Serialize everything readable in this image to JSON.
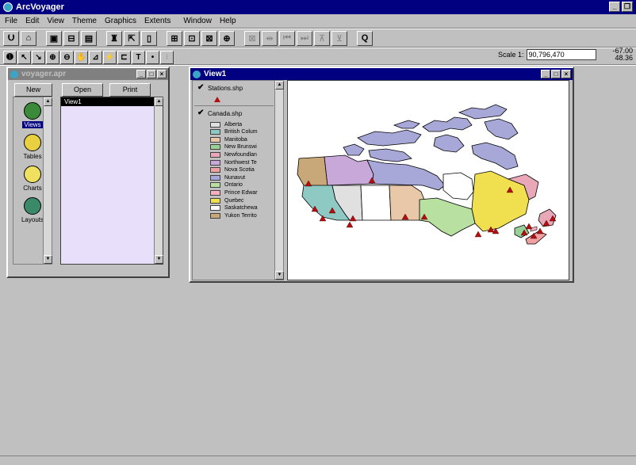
{
  "app": {
    "title": "ArcVoyager"
  },
  "menu": [
    "File",
    "Edit",
    "View",
    "Theme",
    "Graphics",
    "Extents",
    "Window",
    "Help"
  ],
  "scale": {
    "label": "Scale 1:",
    "value": "90,796,470"
  },
  "coords": {
    "x": "-67.00",
    "y": "48.36"
  },
  "project": {
    "title": "voyager.apr",
    "buttons": {
      "new": "New",
      "open": "Open",
      "print": "Print"
    },
    "doc_types": [
      "Views",
      "Tables",
      "Charts",
      "Layouts"
    ],
    "selected_type": "Views",
    "docs": [
      "View1"
    ]
  },
  "view": {
    "title": "View1",
    "themes": [
      {
        "name": "Stations.shp",
        "checked": true
      },
      {
        "name": "Canada.shp",
        "checked": true
      }
    ],
    "legend": [
      {
        "label": "Alberta",
        "color": "#e0e0e0"
      },
      {
        "label": "British Colum",
        "color": "#8fc9c4"
      },
      {
        "label": "Manitoba",
        "color": "#e8c8a8"
      },
      {
        "label": "New Brunswi",
        "color": "#98d098"
      },
      {
        "label": "Newfoundlan",
        "color": "#e8a8b8"
      },
      {
        "label": "Northwest Te",
        "color": "#c8a8d8"
      },
      {
        "label": "Nova Scotia",
        "color": "#f0a0a0"
      },
      {
        "label": "Nunavut",
        "color": "#a8a8d8"
      },
      {
        "label": "Ontario",
        "color": "#b8e0a0"
      },
      {
        "label": "Prince Edwar",
        "color": "#f8b0c0"
      },
      {
        "label": "Quebec",
        "color": "#f0e050"
      },
      {
        "label": "Saskatchewa",
        "color": "#ffffff"
      },
      {
        "label": "Yukon Territo",
        "color": "#c8a878"
      }
    ],
    "station_color": "#b01010"
  }
}
